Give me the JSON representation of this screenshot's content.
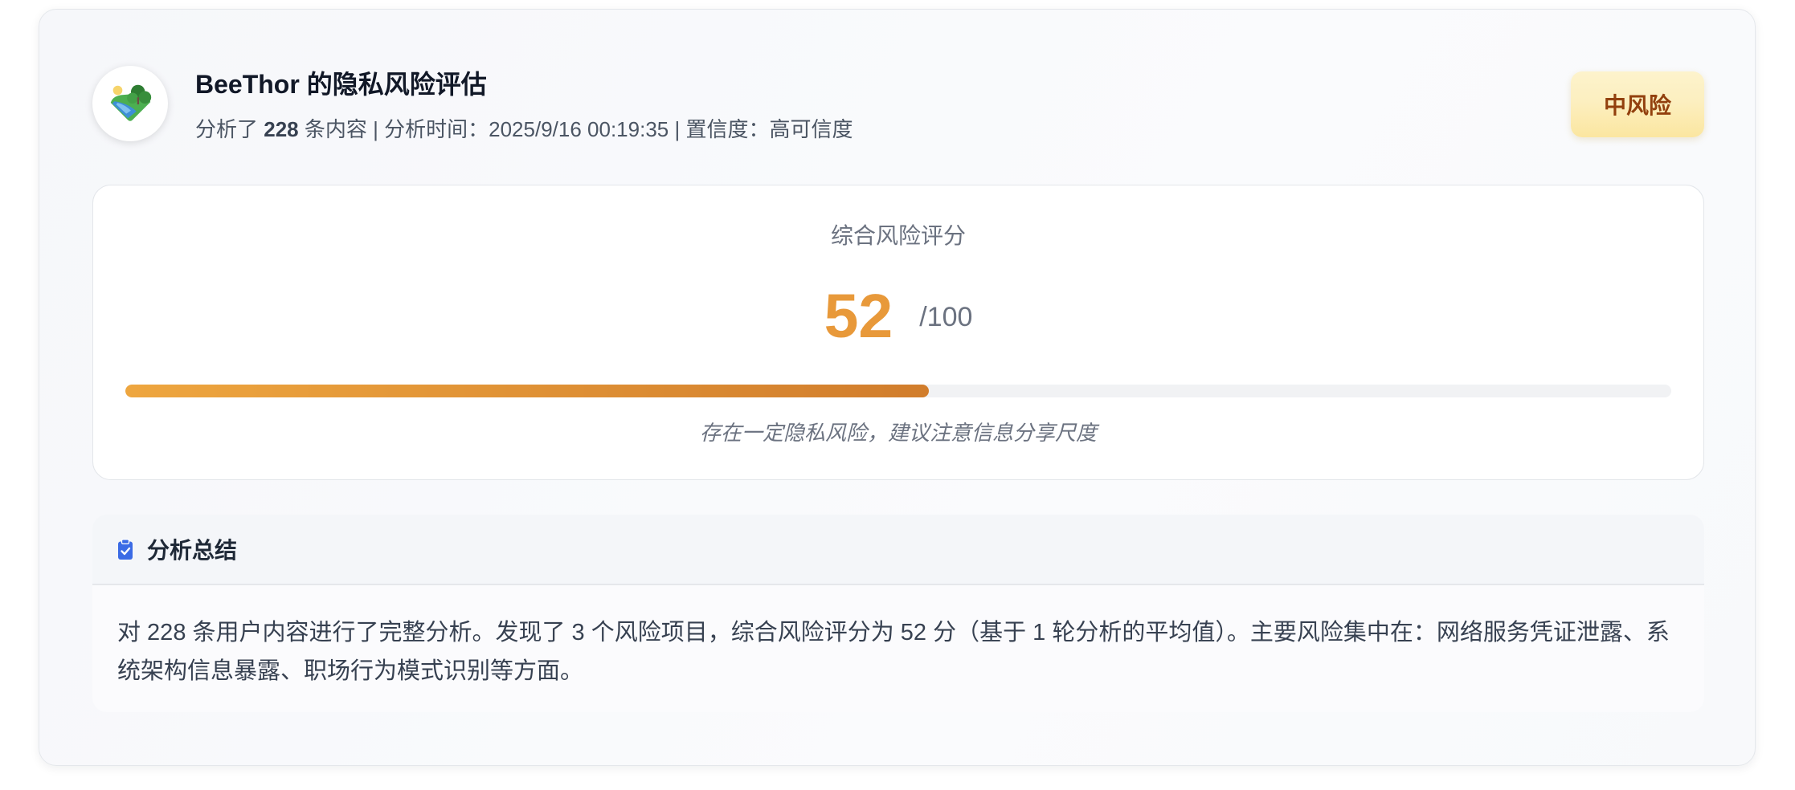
{
  "report": {
    "avatar_icon": "landscape-avatar-icon",
    "title": "BeeThor 的隐私风险评估",
    "meta": {
      "analyzed_prefix": "分析了",
      "content_count": "228",
      "analyzed_suffix": "条内容",
      "separator": "|",
      "time_label": "分析时间：",
      "time_value": "2025/9/16 00:19:35",
      "confidence_label": "置信度：",
      "confidence_value": "高可信度"
    },
    "risk_badge": "中风险"
  },
  "score": {
    "label": "综合风险评分",
    "value": "52",
    "max": "/100",
    "fill": 0.52,
    "note": "存在一定隐私风险，建议注意信息分享尺度"
  },
  "summary": {
    "icon": "clipboard-check-icon",
    "title": "分析总结",
    "body": "对 228 条用户内容进行了完整分析。发现了 3 个风险项目，综合风险评分为 52 分（基于 1 轮分析的平均值）。主要风险集中在：网络服务凭证泄露、系统架构信息暴露、职场行为模式识别等方面。"
  },
  "colors": {
    "score_orange": "#e8993a",
    "bar_start": "#eea63f",
    "bar_end": "#d17d2c",
    "badge_bg": "#fcefc0",
    "badge_text": "#92400e",
    "icon_blue": "#3b6be5"
  }
}
